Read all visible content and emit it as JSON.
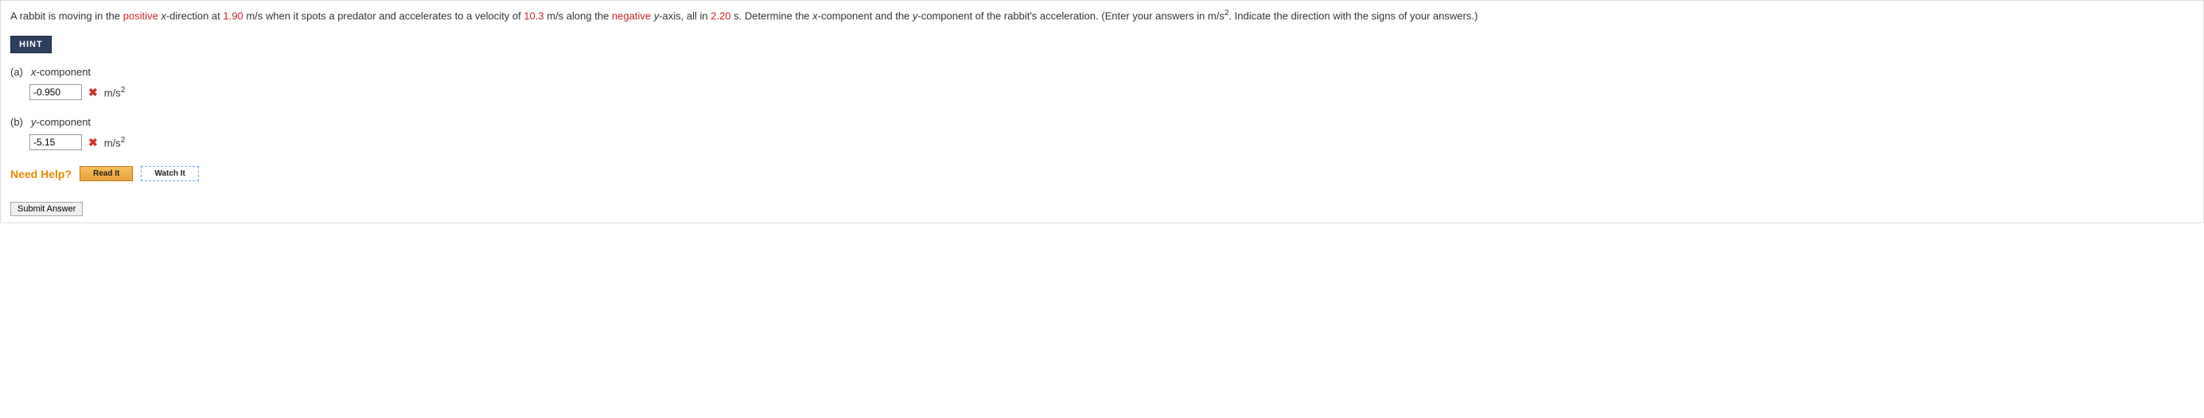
{
  "problem": {
    "t1": "A rabbit is moving in the ",
    "red1": "positive",
    "t2": " ",
    "x_ital": "x",
    "t3": "-direction at ",
    "red2": "1.90",
    "t4": " m/s when it spots a predator and accelerates to a velocity of ",
    "red3": "10.3",
    "t5": " m/s along the ",
    "red4": "negative",
    "t6": " ",
    "y_ital": "y",
    "t7": "-axis, all in ",
    "red5": "2.20",
    "t8": " s. Determine the ",
    "x_ital2": "x",
    "t9": "-component and the ",
    "y_ital2": "y",
    "t10": "-component of the rabbit's acceleration. (Enter your answers in m/s",
    "sup1": "2",
    "t11": ". Indicate the direction with the signs of your answers.)"
  },
  "hint_label": "HINT",
  "parts": {
    "a": {
      "letter": "(a)",
      "var": "x",
      "suffix": "-component",
      "value": "-0.950",
      "mark": "✖",
      "unit_base": "m/s",
      "unit_sup": "2"
    },
    "b": {
      "letter": "(b)",
      "var": "y",
      "suffix": "-component",
      "value": "-5.15",
      "mark": "✖",
      "unit_base": "m/s",
      "unit_sup": "2"
    }
  },
  "need_help": {
    "label": "Need Help?",
    "read": "Read It",
    "watch": "Watch It"
  },
  "submit": "Submit Answer"
}
